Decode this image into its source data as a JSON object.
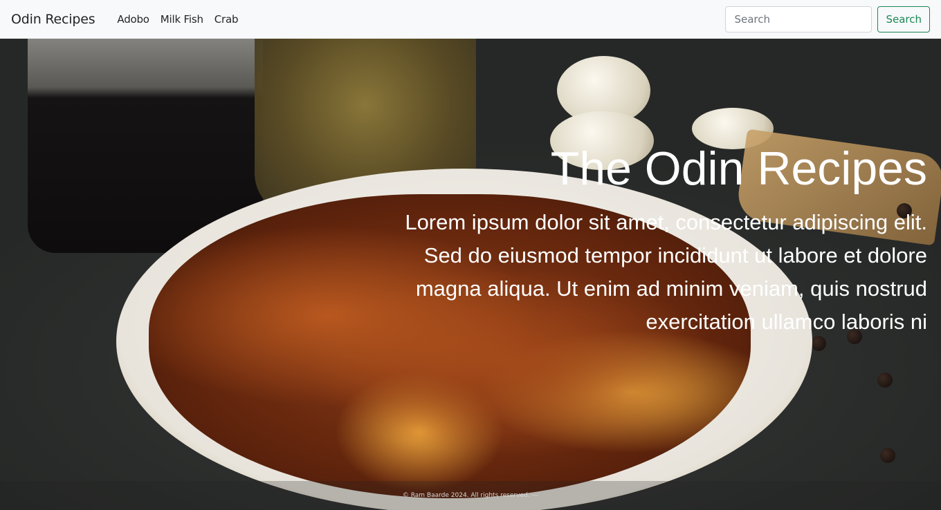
{
  "navbar": {
    "brand": "Odin Recipes",
    "links": [
      "Adobo",
      "Milk Fish",
      "Crab"
    ],
    "search_placeholder": "Search",
    "search_button": "Search"
  },
  "hero": {
    "title": "The Odin Recipes",
    "text": "Lorem ipsum dolor sit amet, consectetur adipiscing elit. Sed do eiusmod tempor incididunt ut labore et dolore magna aliqua. Ut enim ad minim veniam, quis nostrud exercitation ullamco laboris ni"
  },
  "footer": {
    "text": "© Ram Baarde 2024. All rights reserved. ---"
  },
  "colors": {
    "success": "#198754",
    "navbar_bg": "#f8f9fa"
  }
}
